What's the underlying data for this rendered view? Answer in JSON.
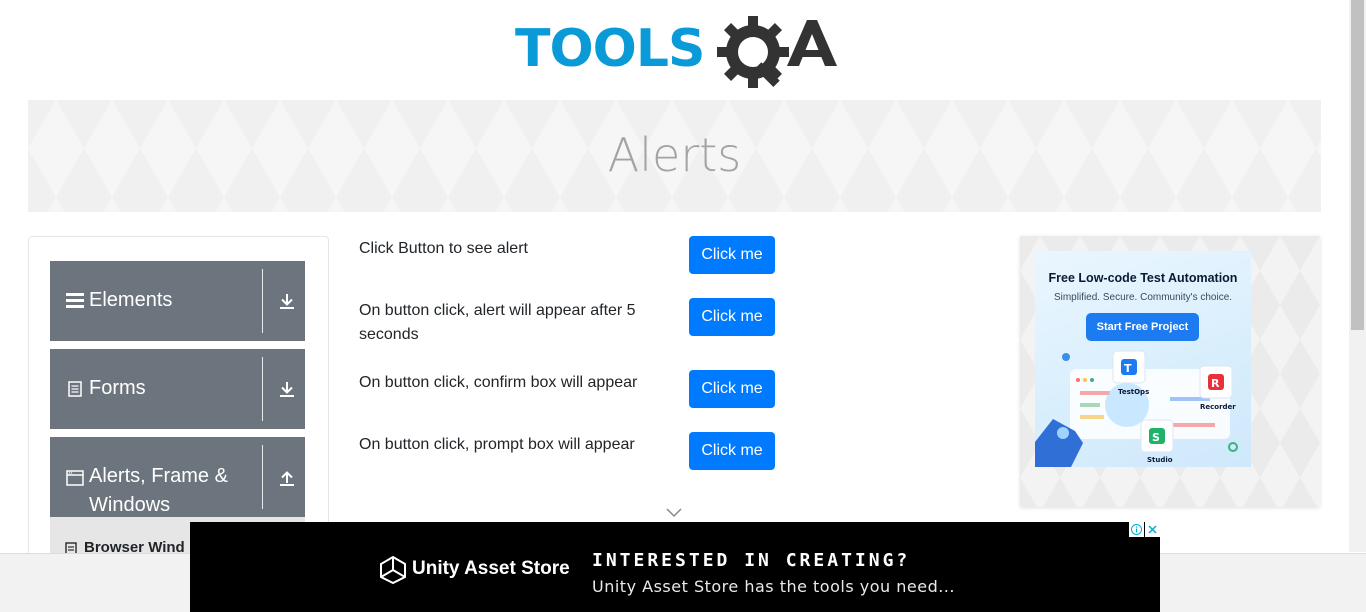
{
  "header": {
    "logo_text": "TOOLSQA",
    "logo_colors": {
      "tools": "#0a9ad7",
      "qa": "#333333"
    }
  },
  "banner": {
    "title": "Alerts"
  },
  "sidebar": {
    "groups": [
      {
        "label": "Elements",
        "icon": "hamburger-icon",
        "arrow": "download-arrow-icon"
      },
      {
        "label": "Forms",
        "icon": "document-icon",
        "arrow": "download-arrow-icon"
      },
      {
        "label": "Alerts, Frame & Windows",
        "label_line1": "Alerts, Frame &",
        "label_line2": "Windows",
        "icon": "browser-window-icon",
        "arrow": "upload-arrow-icon"
      }
    ],
    "submenu": {
      "item": "Browser Wind",
      "icon": "document-icon"
    }
  },
  "main": {
    "rows": [
      {
        "text": "Click Button to see alert",
        "button": "Click me"
      },
      {
        "text": "On button click, alert will appear after 5 seconds",
        "button": "Click me"
      },
      {
        "text": "On button click, confirm box will appear",
        "button": "Click me"
      },
      {
        "text": "On button click, prompt box will appear",
        "button": "Click me"
      }
    ]
  },
  "ad_right": {
    "title": "Free Low-code Test Automation",
    "subtitle": "Simplified. Secure. Community's choice.",
    "cta": "Start Free Project",
    "labels": [
      "TestOps",
      "Recorder",
      "Studio"
    ]
  },
  "ad_bottom": {
    "brand": "Unity Asset Store",
    "headline": "INTERESTED IN CREATING?",
    "tagline": "Unity Asset Store has the tools you need..."
  },
  "colors": {
    "primary_button": "#007bff",
    "sidebar_group": "#6c757d",
    "banner_title": "#a3a3a3"
  }
}
